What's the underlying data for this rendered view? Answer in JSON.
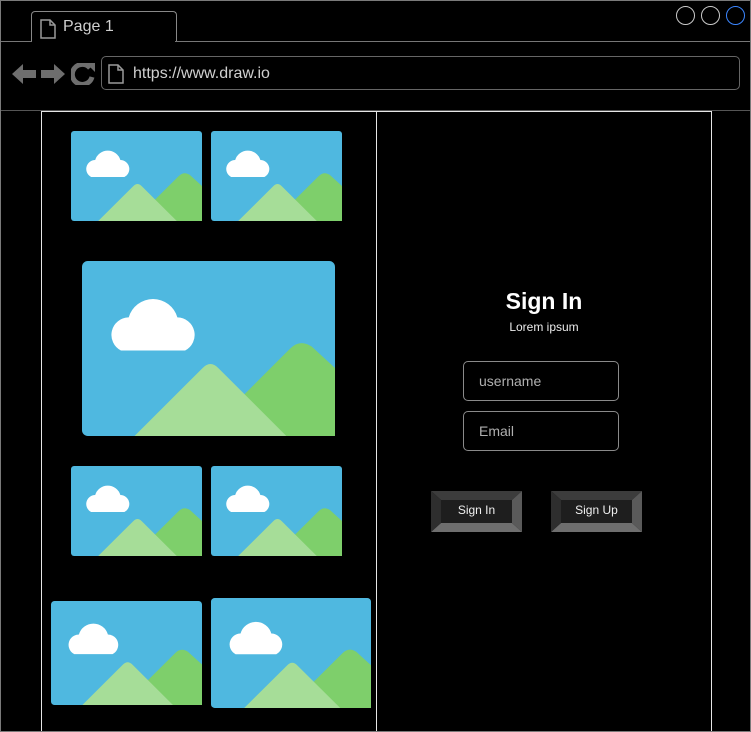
{
  "browser": {
    "tab_label": "Page 1",
    "url": "https://www.draw.io",
    "icons": [
      "page-icon",
      "back-icon",
      "forward-icon",
      "reload-icon",
      "window-control-icon"
    ]
  },
  "gallery": {
    "image_count": 7,
    "colors": {
      "sky": "#4fb8e0",
      "cloud": "#ffffff",
      "hill_front": "#a6dd98",
      "hill_back": "#7ecf6b"
    }
  },
  "signin": {
    "title": "Sign In",
    "subtitle": "Lorem ipsum",
    "username_placeholder": "username",
    "email_placeholder": "Email",
    "signin_label": "Sign In",
    "signup_label": "Sign Up"
  }
}
